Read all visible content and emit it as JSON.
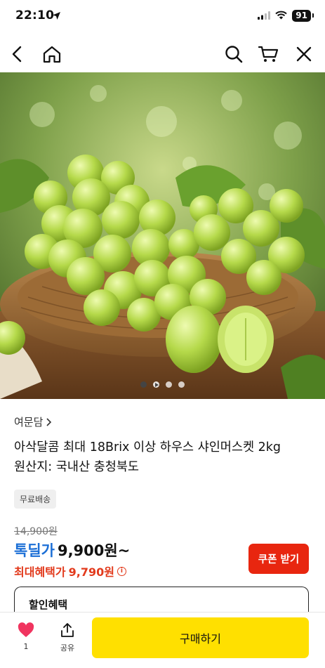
{
  "status_bar": {
    "time": "22:10",
    "battery": "91",
    "icons": [
      "location-arrow-icon",
      "signal-icon",
      "wifi-icon",
      "battery-icon"
    ]
  },
  "nav": {
    "icons": [
      "back-icon",
      "home-icon",
      "search-icon",
      "cart-icon",
      "close-icon"
    ]
  },
  "carousel": {
    "image_subject": "shine muscat grapes",
    "current_index": 1,
    "total": 4
  },
  "product": {
    "brand": "여문담",
    "title_line1": "아삭달콤 최대 18Brix 이상 하우스 샤인머스켓 2kg",
    "title_line2": "원산지: 국내산 충청북도",
    "badge": "무료배송",
    "original_price": "14,900원",
    "price_label": "톡딜가",
    "price_value": "9,900원~",
    "max_benefit_label": "최대혜택가",
    "max_benefit_value": "9,790원",
    "coupon_button": "쿠폰 받기"
  },
  "discount_section": {
    "title": "할인혜택"
  },
  "bottom_bar": {
    "like_count": "1",
    "share_label": "공유",
    "buy_label": "구매하기"
  },
  "colors": {
    "price_blue": "#1c6fd6",
    "benefit_red": "#e23a1c",
    "coupon_red": "#e8260f",
    "buy_yellow": "#ffe000",
    "heart_pink": "#f0345f"
  }
}
